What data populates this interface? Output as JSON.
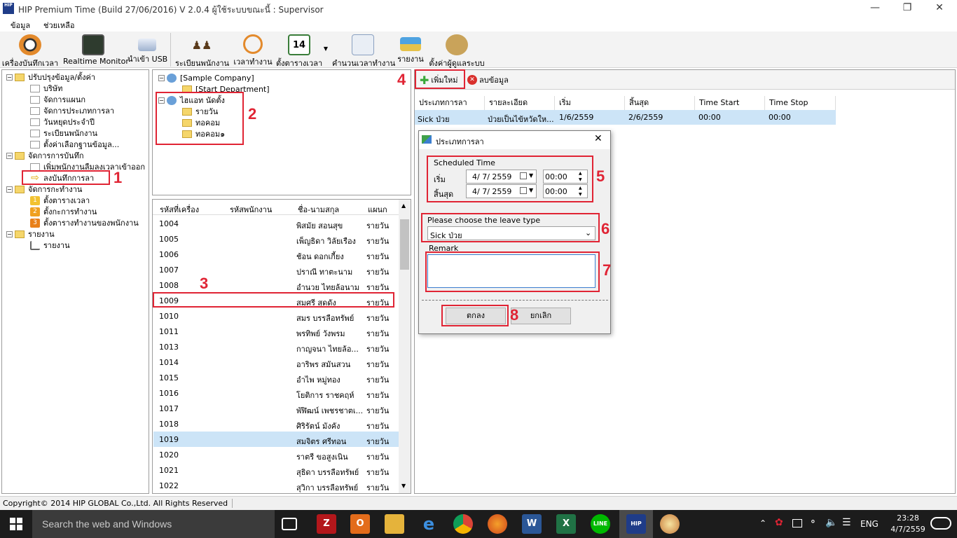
{
  "window": {
    "title": "HIP Premium Time (Build 27/06/2016) V 2.0.4   ผู้ใช้ระบบขณะนี้ : Supervisor",
    "logo_text": "HIP"
  },
  "menu": [
    "ข้อมูล",
    "ช่วยเหลือ"
  ],
  "toolbar": {
    "buttons": [
      "เครื่องบันทึกเวลา",
      "Realtime Monitor",
      "นำเข้า USB",
      "ระเบียนพนักงาน",
      "เวลาทำงาน",
      "ตั้งตารางเวลา",
      "คำนวนเวลาทำงาน",
      "รายงาน",
      "ตั้งค่าผู้ดูแลระบบ"
    ],
    "calendar_day": "14"
  },
  "left_tree": {
    "groups": [
      {
        "label": "ปรับปรุงข้อมูล/ตั้งค่า",
        "items": [
          "บริษัท",
          "จัดการแผนก",
          "จัดการประเภทการลา",
          "วันหยุดประจำปี",
          "ระเบียนพนักงาน",
          "ตั้งค่าเลือกฐานข้อมูล..."
        ]
      },
      {
        "label": "จัดการการบันทึก",
        "items": [
          "เพิ่มพนักงานลืมลงเวลาเข้าออก",
          "ลงบันทึกการลา"
        ]
      },
      {
        "label": "จัดการกะทำงาน",
        "items": [
          "ตั้งตารางเวลา",
          "ตั้งกะการทำงาน",
          "ตั้งตารางทำงานของพนักงาน"
        ]
      },
      {
        "label": "รายงาน",
        "items": [
          "รายงาน"
        ]
      }
    ],
    "shift_badges": [
      "1",
      "2",
      "3"
    ]
  },
  "company_tree": {
    "company": "[Sample Company]",
    "department": "[Start Department]",
    "branch": "ไฮแอท นัดตั้ง",
    "sub_items": [
      "รายวัน",
      "ทอคอม",
      "ทอคอม๑"
    ]
  },
  "employee_list": {
    "columns": [
      "รหัสที่เครื่อง",
      "รหัสพนักงาน",
      "ชื่อ-นามสกุล",
      "แผนก"
    ],
    "rows": [
      {
        "id": "1004",
        "emp": "",
        "name": "พิสมัย  สอนสุข",
        "dept": "รายวัน"
      },
      {
        "id": "1005",
        "emp": "",
        "name": "เพ็ญธิดา  วิลัยเรือง",
        "dept": "รายวัน"
      },
      {
        "id": "1006",
        "emp": "",
        "name": "ช้อน ดอกเกี้ยง",
        "dept": "รายวัน"
      },
      {
        "id": "1007",
        "emp": "",
        "name": "ปราณี  ทาตะนาม",
        "dept": "รายวัน"
      },
      {
        "id": "1008",
        "emp": "",
        "name": "อำนวย  ไทยล้อนาม",
        "dept": "รายวัน"
      },
      {
        "id": "1009",
        "emp": "",
        "name": "สมศรี  สุดดัง",
        "dept": "รายวัน"
      },
      {
        "id": "1010",
        "emp": "",
        "name": "สมร  บรรลือทรัพย์",
        "dept": "รายวัน"
      },
      {
        "id": "1011",
        "emp": "",
        "name": "พรทิพย์  วังพรม",
        "dept": "รายวัน"
      },
      {
        "id": "1013",
        "emp": "",
        "name": "กาญจนา ไทยล้อ...",
        "dept": "รายวัน"
      },
      {
        "id": "1014",
        "emp": "",
        "name": "อาริพร  สมันสวน",
        "dept": "รายวัน"
      },
      {
        "id": "1015",
        "emp": "",
        "name": "อำไพ  หมู่ทอง",
        "dept": "รายวัน"
      },
      {
        "id": "1016",
        "emp": "",
        "name": "โยติการ ราชคฤห์",
        "dept": "รายวัน"
      },
      {
        "id": "1017",
        "emp": "",
        "name": "พัฬิฒน์ เพชรชาตเ...",
        "dept": "รายวัน"
      },
      {
        "id": "1018",
        "emp": "",
        "name": "ศิริรัตน์  มังคัง",
        "dept": "รายวัน"
      },
      {
        "id": "1019",
        "emp": "",
        "name": "สมจิตร ศรีทอน",
        "dept": "รายวัน"
      },
      {
        "id": "1020",
        "emp": "",
        "name": "ราตรี ขอสูงเนิน",
        "dept": "รายวัน"
      },
      {
        "id": "1021",
        "emp": "",
        "name": "สุธิดา  บรรลือทรัพย์",
        "dept": "รายวัน"
      },
      {
        "id": "1022",
        "emp": "",
        "name": "สุวิกา บรรลือทรัพย์",
        "dept": "รายวัน"
      }
    ]
  },
  "leave_panel": {
    "add_label": "เพิ่มใหม่",
    "delete_label": "ลบข้อมูล",
    "columns": [
      "ประเภทการลา",
      "รายละเอียด",
      "เริ่ม",
      "สิ้นสุด",
      "Time Start",
      "Time Stop"
    ],
    "rows": [
      {
        "type": "Sick ป่วย",
        "detail": "ป่วยเป็นไข้หวัดให...",
        "start": "1/6/2559",
        "end": "2/6/2559",
        "tstart": "00:00",
        "tstop": "00:00"
      }
    ]
  },
  "dialog": {
    "title": "ประเภทการลา",
    "scheduled_label": "Scheduled Time",
    "start_label": "เริ่ม",
    "end_label": "สิ้นสุด",
    "start_date": "4/  7/  2559",
    "end_date": "4/  7/  2559",
    "start_time": "00:00",
    "end_time": "00:00",
    "leave_type_label": "Please choose the leave type",
    "leave_type_value": "Sick ป่วย",
    "remark_label": "Remark",
    "remark_value": "",
    "ok_label": "ตกลง",
    "cancel_label": "ยกเลิก"
  },
  "annotations": [
    "1",
    "2",
    "3",
    "4",
    "5",
    "6",
    "7",
    "8"
  ],
  "status": {
    "copyright": "Copyright© 2014 HIP GLOBAL Co.,Ltd. All Rights Reserved"
  },
  "taskbar": {
    "search_placeholder": "Search the web and Windows",
    "lang": "ENG",
    "time": "23:28",
    "date": "4/7/2559",
    "hip_label": "HIP"
  },
  "colors": {
    "annotation": "#e02434",
    "selection": "#cce4f7",
    "taskbar": "#1c1c1c"
  }
}
